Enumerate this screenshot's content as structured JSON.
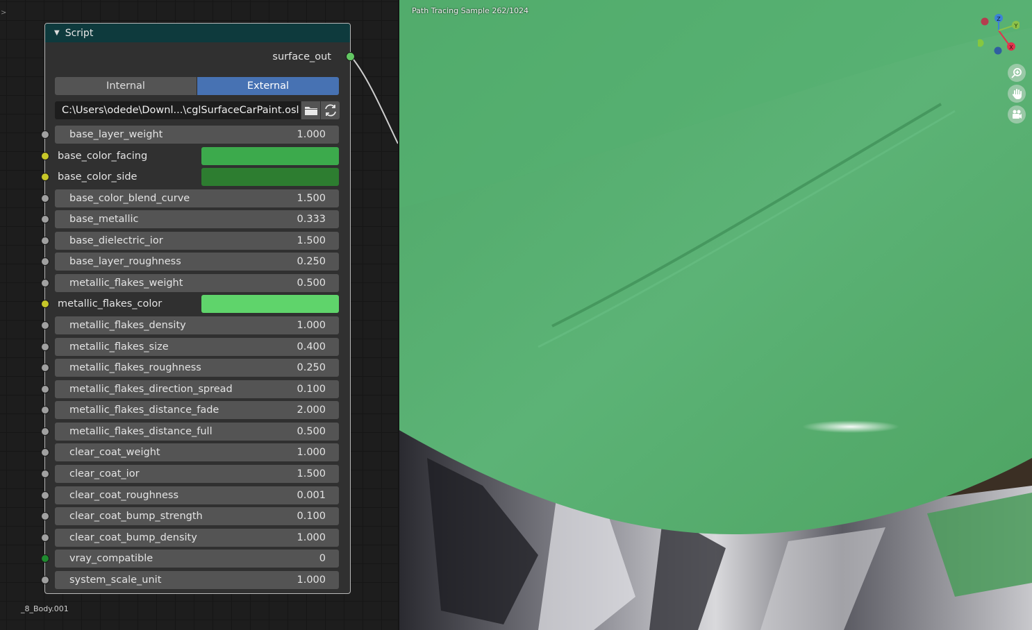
{
  "node": {
    "title": "Script",
    "output": "surface_out",
    "mode_options": [
      "Internal",
      "External"
    ],
    "mode_selected": "External",
    "filepath": "C:\\Users\\odede\\Downl...\\cglSurfaceCarPaint.osl",
    "icons": {
      "browse": "folder-icon",
      "reload": "reload-icon"
    },
    "inputs": [
      {
        "label": "base_layer_weight",
        "value": "1.000",
        "kind": "float"
      },
      {
        "label": "base_color_facing",
        "kind": "color",
        "color": "#3caa4c"
      },
      {
        "label": "base_color_side",
        "kind": "color",
        "color": "#2d7d30"
      },
      {
        "label": "base_color_blend_curve",
        "value": "1.500",
        "kind": "float"
      },
      {
        "label": "base_metallic",
        "value": "0.333",
        "kind": "float"
      },
      {
        "label": "base_dielectric_ior",
        "value": "1.500",
        "kind": "float"
      },
      {
        "label": "base_layer_roughness",
        "value": "0.250",
        "kind": "float"
      },
      {
        "label": "metallic_flakes_weight",
        "value": "0.500",
        "kind": "float"
      },
      {
        "label": "metallic_flakes_color",
        "kind": "color",
        "color": "#5fd46b"
      },
      {
        "label": "metallic_flakes_density",
        "value": "1.000",
        "kind": "float"
      },
      {
        "label": "metallic_flakes_size",
        "value": "0.400",
        "kind": "float"
      },
      {
        "label": "metallic_flakes_roughness",
        "value": "0.250",
        "kind": "float"
      },
      {
        "label": "metallic_flakes_direction_spread",
        "value": "0.100",
        "kind": "float"
      },
      {
        "label": "metallic_flakes_distance_fade",
        "value": "2.000",
        "kind": "float"
      },
      {
        "label": "metallic_flakes_distance_full",
        "value": "0.500",
        "kind": "float"
      },
      {
        "label": "clear_coat_weight",
        "value": "1.000",
        "kind": "float"
      },
      {
        "label": "clear_coat_ior",
        "value": "1.500",
        "kind": "float"
      },
      {
        "label": "clear_coat_roughness",
        "value": "0.001",
        "kind": "float"
      },
      {
        "label": "clear_coat_bump_strength",
        "value": "0.100",
        "kind": "float"
      },
      {
        "label": "clear_coat_bump_density",
        "value": "1.000",
        "kind": "float"
      },
      {
        "label": "vray_compatible",
        "value": "0",
        "kind": "int"
      },
      {
        "label": "system_scale_unit",
        "value": "1.000",
        "kind": "float"
      }
    ]
  },
  "editor": {
    "object_label": "_8_Body.001"
  },
  "viewport": {
    "status": "Path Tracing Sample 262/1024",
    "gizmo_axes": [
      "Z",
      "Y",
      "X"
    ],
    "nav_icons": [
      "zoom-icon",
      "hand-pan-icon",
      "camera-icon"
    ],
    "colors": {
      "paint": "#55ad6f",
      "axis_x": "#e0344d",
      "axis_y": "#8bc24a",
      "axis_z": "#3d82d6"
    }
  }
}
